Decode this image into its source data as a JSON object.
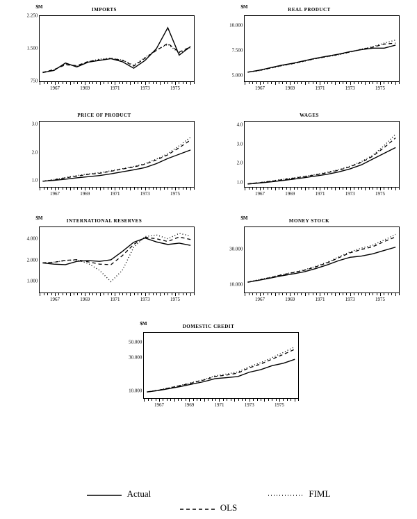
{
  "legend": {
    "actual": "Actual",
    "fiml": "FIML",
    "ols": "OLS"
  },
  "x_years_major": [
    1967,
    1969,
    1971,
    1973,
    1975
  ],
  "chart_data": [
    {
      "id": "imports",
      "title": "IMPORTS",
      "y_unit_label": "$M",
      "type": "line",
      "scale": "linear",
      "ylim": [
        750,
        2250
      ],
      "yticks": [
        750,
        1500,
        2250
      ],
      "ytick_labels": [
        "750",
        "1.500",
        "2.250"
      ],
      "x_years": [
        1966,
        1967,
        1968,
        1969,
        1970,
        1971,
        1972,
        1973,
        1974,
        1975,
        1976
      ],
      "xlabel": "",
      "ylabel": "",
      "series": [
        {
          "name": "Actual",
          "style": "solid",
          "values": [
            950,
            1000,
            1170,
            1080,
            1190,
            1230,
            1270,
            1200,
            1050,
            1230,
            1500,
            1980,
            1350,
            1550
          ]
        },
        {
          "name": "FIML",
          "style": "dot",
          "values": [
            950,
            1010,
            1150,
            1100,
            1200,
            1260,
            1280,
            1240,
            1120,
            1300,
            1470,
            1600,
            1400,
            1525
          ]
        },
        {
          "name": "OLS",
          "style": "dash",
          "values": [
            955,
            1020,
            1130,
            1110,
            1205,
            1240,
            1275,
            1235,
            1100,
            1280,
            1460,
            1620,
            1420,
            1540
          ]
        }
      ]
    },
    {
      "id": "real-product",
      "title": "REAL PRODUCT",
      "y_unit_label": "$M",
      "type": "line",
      "scale": "linear",
      "ylim": [
        4500,
        11000
      ],
      "yticks": [
        5000,
        7500,
        10000
      ],
      "ytick_labels": [
        "5.000",
        "7.500",
        "10.000"
      ],
      "x_years": [
        1966,
        1967,
        1968,
        1969,
        1970,
        1971,
        1972,
        1973,
        1974,
        1975,
        1976
      ],
      "xlabel": "",
      "ylabel": "",
      "series": [
        {
          "name": "Actual",
          "style": "solid",
          "values": [
            5400,
            5600,
            5850,
            6100,
            6300,
            6550,
            6800,
            7000,
            7200,
            7450,
            7650,
            7800,
            7800,
            8100
          ]
        },
        {
          "name": "FIML",
          "style": "dot",
          "values": [
            5400,
            5550,
            5800,
            6050,
            6250,
            6500,
            6750,
            6950,
            7150,
            7400,
            7700,
            7950,
            8300,
            8600
          ]
        },
        {
          "name": "OLS",
          "style": "dash",
          "values": [
            5420,
            5570,
            5820,
            6070,
            6270,
            6520,
            6770,
            6970,
            7170,
            7420,
            7680,
            7900,
            8200,
            8300
          ]
        }
      ]
    },
    {
      "id": "price-product",
      "title": "PRICE OF PRODUCT",
      "y_unit_label": "",
      "type": "line",
      "scale": "linear",
      "ylim": [
        0.8,
        3.1
      ],
      "yticks": [
        1.0,
        2.0,
        3.0
      ],
      "ytick_labels": [
        "1.0",
        "2.0",
        "3.0"
      ],
      "x_years": [
        1966,
        1967,
        1968,
        1969,
        1970,
        1971,
        1972,
        1973,
        1974,
        1975,
        1976
      ],
      "xlabel": "",
      "ylabel": "",
      "series": [
        {
          "name": "Actual",
          "style": "solid",
          "values": [
            1.0,
            1.03,
            1.07,
            1.12,
            1.16,
            1.2,
            1.26,
            1.33,
            1.4,
            1.48,
            1.62,
            1.8,
            1.95,
            2.1
          ]
        },
        {
          "name": "FIML",
          "style": "dot",
          "values": [
            1.0,
            1.06,
            1.13,
            1.2,
            1.26,
            1.3,
            1.37,
            1.44,
            1.52,
            1.62,
            1.78,
            1.97,
            2.25,
            2.55
          ]
        },
        {
          "name": "OLS",
          "style": "dash",
          "values": [
            1.0,
            1.05,
            1.12,
            1.18,
            1.24,
            1.28,
            1.35,
            1.43,
            1.5,
            1.6,
            1.75,
            1.93,
            2.18,
            2.45
          ]
        }
      ]
    },
    {
      "id": "wages",
      "title": "WAGES",
      "y_unit_label": "",
      "type": "line",
      "scale": "linear",
      "ylim": [
        0.8,
        4.2
      ],
      "yticks": [
        1.0,
        2.0,
        3.0,
        4.0
      ],
      "ytick_labels": [
        "1.0",
        "2.0",
        "3.0",
        "4.0"
      ],
      "x_years": [
        1966,
        1967,
        1968,
        1969,
        1970,
        1971,
        1972,
        1973,
        1974,
        1975,
        1976
      ],
      "xlabel": "",
      "ylabel": "",
      "series": [
        {
          "name": "Actual",
          "style": "solid",
          "values": [
            0.95,
            1.0,
            1.06,
            1.13,
            1.2,
            1.28,
            1.37,
            1.46,
            1.58,
            1.74,
            1.95,
            2.25,
            2.55,
            2.85
          ]
        },
        {
          "name": "FIML",
          "style": "dot",
          "values": [
            0.96,
            1.02,
            1.1,
            1.19,
            1.27,
            1.35,
            1.45,
            1.56,
            1.7,
            1.88,
            2.12,
            2.45,
            2.95,
            3.55
          ]
        },
        {
          "name": "OLS",
          "style": "dash",
          "values": [
            0.96,
            1.02,
            1.09,
            1.17,
            1.25,
            1.34,
            1.43,
            1.54,
            1.67,
            1.85,
            2.08,
            2.4,
            2.85,
            3.35
          ]
        }
      ]
    },
    {
      "id": "intl-reserves",
      "title": "INTERNATIONAL RESERVES",
      "y_unit_label": "$M",
      "type": "line",
      "scale": "log",
      "ylim": [
        700,
        6000
      ],
      "yticks": [
        1000,
        2000,
        4000
      ],
      "ytick_labels": [
        "1.000",
        "2.000",
        "4.000"
      ],
      "x_years": [
        1966,
        1967,
        1968,
        1969,
        1970,
        1971,
        1972,
        1973,
        1974,
        1975,
        1976
      ],
      "xlabel": "",
      "ylabel": "",
      "series": [
        {
          "name": "Actual",
          "style": "solid",
          "values": [
            1850,
            1780,
            1750,
            1950,
            2000,
            1950,
            2050,
            2700,
            3650,
            4200,
            3700,
            3400,
            3550,
            3300
          ]
        },
        {
          "name": "FIML",
          "style": "dot",
          "values": [
            1850,
            1900,
            2000,
            2050,
            1820,
            1450,
            1000,
            1450,
            3100,
            4400,
            4650,
            4100,
            4900,
            4500
          ]
        },
        {
          "name": "OLS",
          "style": "dash",
          "values": [
            1860,
            1890,
            2020,
            2060,
            1920,
            1780,
            1750,
            2350,
            3400,
            4300,
            4100,
            3750,
            4350,
            4000
          ]
        }
      ]
    },
    {
      "id": "money-stock",
      "title": "MONEY STOCK",
      "y_unit_label": "$M",
      "type": "line",
      "scale": "log",
      "ylim": [
        8000,
        60000
      ],
      "yticks": [
        10000,
        30000
      ],
      "ytick_labels": [
        "10.000",
        "30.000"
      ],
      "x_years": [
        1966,
        1967,
        1968,
        1969,
        1970,
        1971,
        1972,
        1973,
        1974,
        1975,
        1976
      ],
      "xlabel": "",
      "ylabel": "",
      "series": [
        {
          "name": "Actual",
          "style": "solid",
          "values": [
            11000,
            11700,
            12500,
            13400,
            14200,
            15200,
            16800,
            18800,
            21400,
            23700,
            24600,
            26400,
            29300,
            32400
          ]
        },
        {
          "name": "FIML",
          "style": "dot",
          "values": [
            11000,
            11900,
            12800,
            13900,
            14900,
            16100,
            18000,
            20400,
            24000,
            28000,
            31500,
            34500,
            40500,
            48000
          ]
        },
        {
          "name": "OLS",
          "style": "dash",
          "values": [
            11000,
            11800,
            12700,
            13800,
            14800,
            15900,
            17700,
            20000,
            23400,
            27200,
            30200,
            32900,
            38500,
            44500
          ]
        }
      ]
    },
    {
      "id": "domestic-credit",
      "title": "DOMESTIC CREDIT",
      "y_unit_label": "$M",
      "type": "line",
      "scale": "log",
      "ylim": [
        8000,
        70000
      ],
      "yticks": [
        10000,
        30000,
        50000
      ],
      "ytick_labels": [
        "10.000",
        "30.000",
        "50.000"
      ],
      "x_years": [
        1966,
        1967,
        1968,
        1969,
        1970,
        1971,
        1972,
        1973,
        1974,
        1975,
        1976
      ],
      "xlabel": "",
      "ylabel": "",
      "series": [
        {
          "name": "Actual",
          "style": "solid",
          "values": [
            9800,
            10300,
            11000,
            11800,
            12800,
            13800,
            15300,
            15800,
            16400,
            18900,
            20600,
            23500,
            25500,
            29000
          ]
        },
        {
          "name": "FIML",
          "style": "dot",
          "values": [
            9800,
            10450,
            11300,
            12300,
            13500,
            14800,
            16800,
            17800,
            19100,
            22700,
            26000,
            30700,
            36500,
            44000
          ]
        },
        {
          "name": "OLS",
          "style": "dash",
          "values": [
            9820,
            10400,
            11250,
            12200,
            13300,
            14600,
            16400,
            17200,
            18400,
            21900,
            24800,
            29200,
            34200,
            40500
          ]
        }
      ]
    }
  ]
}
